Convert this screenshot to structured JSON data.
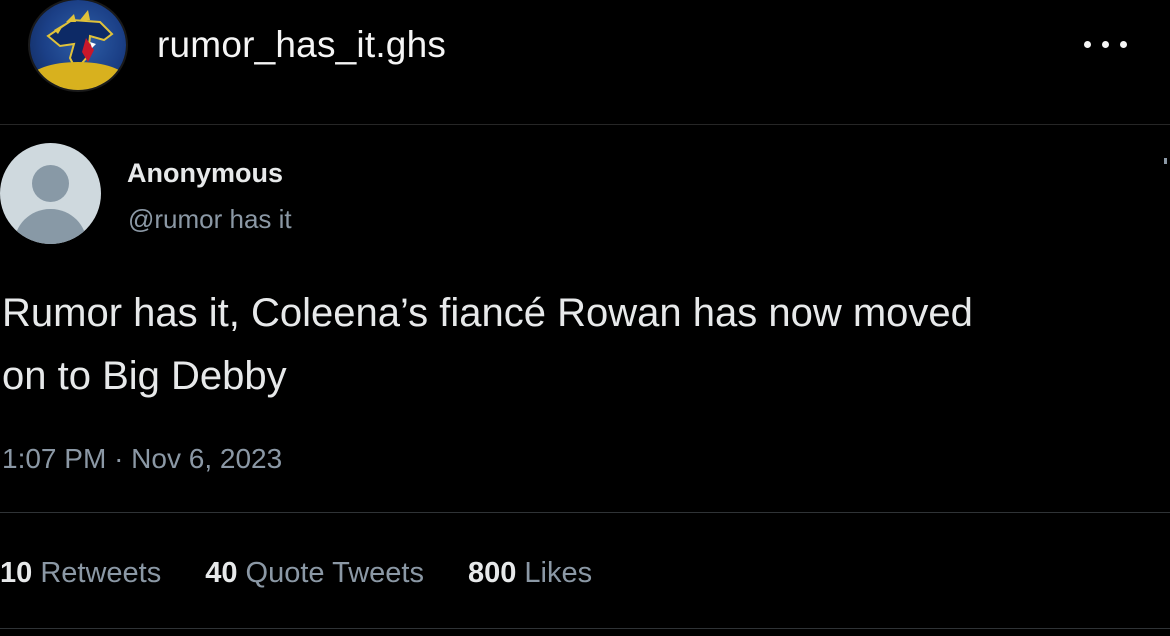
{
  "header": {
    "username": "rumor_has_it.ghs",
    "more_icon": "ellipsis-horizontal-icon"
  },
  "tweet": {
    "display_name": "Anonymous",
    "handle": "@rumor has it",
    "text_lines": [
      "Rumor has it, Coleena’s fiancé Rowan has now moved",
      "on to Big Debby"
    ],
    "time": "1:07 PM",
    "separator": "·",
    "date": "Nov 6, 2023",
    "stats": [
      {
        "count": "10",
        "label": "Retweets"
      },
      {
        "count": "40",
        "label": "Quote Tweets"
      },
      {
        "count": "800",
        "label": "Likes"
      }
    ]
  },
  "colors": {
    "background": "#000000",
    "primary_text": "#e7e9ea",
    "secondary_text": "#8b98a5",
    "divider": "#2f3336",
    "avatar_placeholder": "#cfd9de"
  }
}
